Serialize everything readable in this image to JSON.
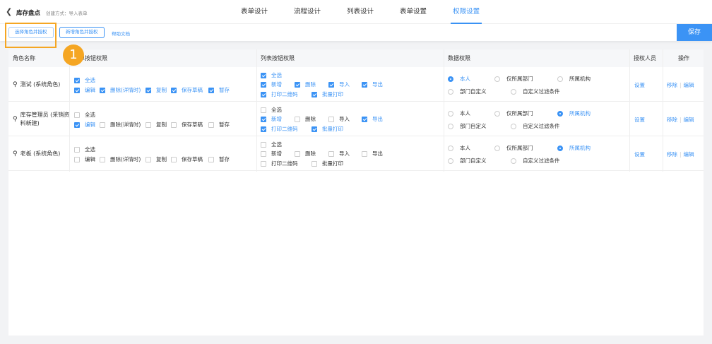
{
  "header": {
    "back_icon": "chevron-left-icon",
    "title": "库存盘点",
    "subtitle": "创建方式：导入表单",
    "tabs": [
      {
        "label": "表单设计"
      },
      {
        "label": "流程设计"
      },
      {
        "label": "列表设计"
      },
      {
        "label": "表单设置"
      },
      {
        "label": "权限设置",
        "active": true
      }
    ]
  },
  "toolbar": {
    "select_role": "选择角色并授权",
    "add_role": "新增角色并授权",
    "help": "帮助文档",
    "save": "保存"
  },
  "annotation": {
    "step": "1"
  },
  "accent": "#3b93f5",
  "table": {
    "columns": [
      "角色名称",
      "表单按钮权限",
      "列表按钮权限",
      "数据权限",
      "授权人员",
      "操作"
    ],
    "rows": [
      {
        "name": "测试 (系统角色)",
        "form_all": {
          "label": "全选",
          "checked": true
        },
        "form_items": [
          {
            "label": "编辑",
            "checked": true
          },
          {
            "label": "删除(详情时)",
            "checked": true
          },
          {
            "label": "复制",
            "checked": true
          },
          {
            "label": "保存草稿",
            "checked": true
          },
          {
            "label": "暂存",
            "checked": true
          }
        ],
        "list_all": {
          "label": "全选",
          "checked": true
        },
        "list_items": [
          {
            "label": "新增",
            "checked": true
          },
          {
            "label": "删除",
            "checked": true
          },
          {
            "label": "导入",
            "checked": true
          },
          {
            "label": "导出",
            "checked": true
          },
          {
            "label": "打印二维码",
            "checked": true
          },
          {
            "label": "批量打印",
            "checked": true
          }
        ],
        "data": [
          {
            "label": "本人",
            "checked": true
          },
          {
            "label": "仅所属部门",
            "checked": false
          },
          {
            "label": "所属机构",
            "checked": false
          },
          {
            "label": "部门自定义",
            "checked": false
          },
          {
            "label": "自定义过滤条件",
            "checked": false
          }
        ],
        "auth": "设置",
        "remove": "移除",
        "edit": "编辑"
      },
      {
        "name": "库存管理员 (采销资料新建)",
        "form_all": {
          "label": "全选",
          "checked": false
        },
        "form_items": [
          {
            "label": "编辑",
            "checked": true
          },
          {
            "label": "删除(详情时)",
            "checked": false
          },
          {
            "label": "复制",
            "checked": false
          },
          {
            "label": "保存草稿",
            "checked": false
          },
          {
            "label": "暂存",
            "checked": false
          }
        ],
        "list_all": {
          "label": "全选",
          "checked": false
        },
        "list_items": [
          {
            "label": "新增",
            "checked": true
          },
          {
            "label": "删除",
            "checked": false
          },
          {
            "label": "导入",
            "checked": false
          },
          {
            "label": "导出",
            "checked": true
          },
          {
            "label": "打印二维码",
            "checked": true
          },
          {
            "label": "批量打印",
            "checked": true
          }
        ],
        "data": [
          {
            "label": "本人",
            "checked": false
          },
          {
            "label": "仅所属部门",
            "checked": false
          },
          {
            "label": "所属机构",
            "checked": true
          },
          {
            "label": "部门自定义",
            "checked": false
          },
          {
            "label": "自定义过滤条件",
            "checked": false
          }
        ],
        "auth": "设置",
        "remove": "移除",
        "edit": "编辑"
      },
      {
        "name": "老板 (系统角色)",
        "form_all": {
          "label": "全选",
          "checked": false
        },
        "form_items": [
          {
            "label": "编辑",
            "checked": false
          },
          {
            "label": "删除(详情时)",
            "checked": false
          },
          {
            "label": "复制",
            "checked": false
          },
          {
            "label": "保存草稿",
            "checked": false
          },
          {
            "label": "暂存",
            "checked": false
          }
        ],
        "list_all": {
          "label": "全选",
          "checked": false
        },
        "list_items": [
          {
            "label": "新增",
            "checked": false
          },
          {
            "label": "删除",
            "checked": false
          },
          {
            "label": "导入",
            "checked": false
          },
          {
            "label": "导出",
            "checked": false
          },
          {
            "label": "打印二维码",
            "checked": false
          },
          {
            "label": "批量打印",
            "checked": false
          }
        ],
        "data": [
          {
            "label": "本人",
            "checked": false
          },
          {
            "label": "仅所属部门",
            "checked": false
          },
          {
            "label": "所属机构",
            "checked": true
          },
          {
            "label": "部门自定义",
            "checked": false
          },
          {
            "label": "自定义过滤条件",
            "checked": false
          }
        ],
        "auth": "设置",
        "remove": "移除",
        "edit": "编辑"
      }
    ]
  }
}
